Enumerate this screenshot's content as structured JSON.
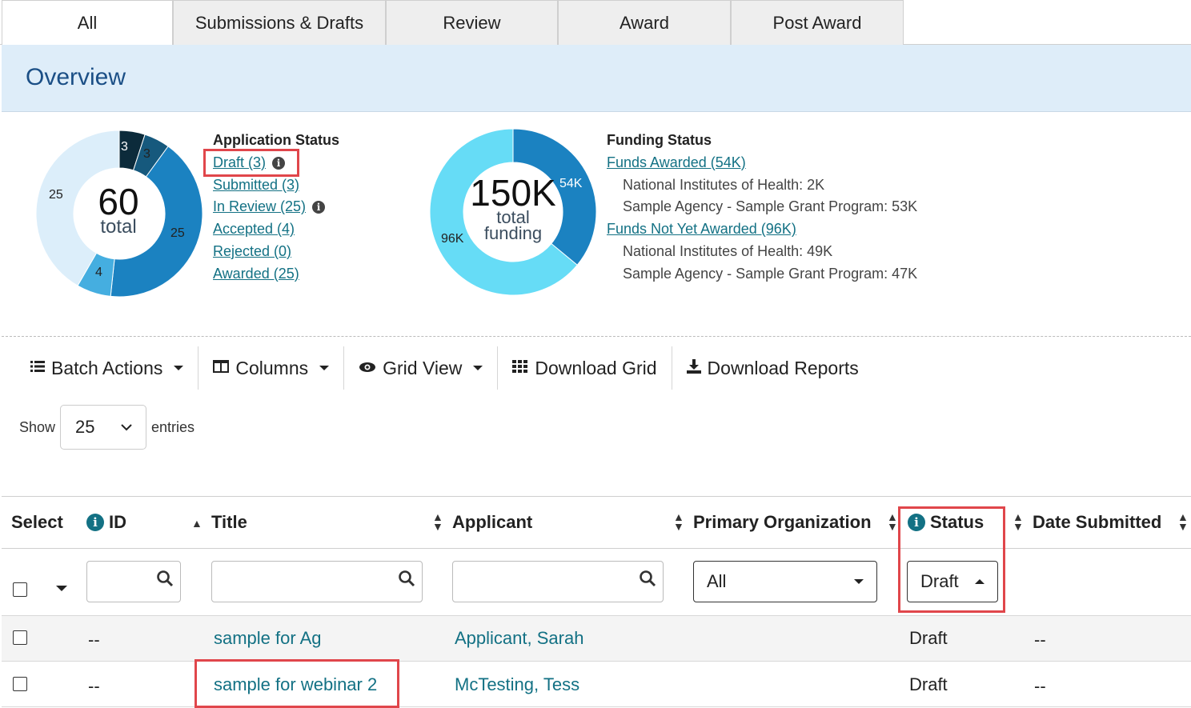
{
  "tabs": [
    "All",
    "Submissions & Drafts",
    "Review",
    "Award",
    "Post Award"
  ],
  "overview": {
    "title": "Overview"
  },
  "application_chart": {
    "center_value": "60",
    "center_label": "total",
    "segments": [
      {
        "label": "3",
        "value": 3,
        "color": "#0c2b3b"
      },
      {
        "label": "3",
        "value": 3,
        "color": "#16597d"
      },
      {
        "label": "25",
        "value": 25,
        "color": "#1b82c1"
      },
      {
        "label": "4",
        "value": 4,
        "color": "#45aee0"
      },
      {
        "label": "25",
        "value": 25,
        "color": "#dceefa"
      }
    ]
  },
  "application_status": {
    "title": "Application Status",
    "items": [
      {
        "label": "Draft (3)",
        "info": true
      },
      {
        "label": "Submitted (3)",
        "info": false
      },
      {
        "label": "In Review (25)",
        "info": true
      },
      {
        "label": "Accepted (4)",
        "info": false
      },
      {
        "label": "Rejected (0)",
        "info": false
      },
      {
        "label": "Awarded (25)",
        "info": false
      }
    ]
  },
  "funding_chart": {
    "center_value": "150K",
    "center_label_1": "total",
    "center_label_2": "funding",
    "segments": [
      {
        "label": "54K",
        "value": 54,
        "color": "#1b82c1"
      },
      {
        "label": "96K",
        "value": 96,
        "color": "#66dcf6"
      }
    ]
  },
  "funding_status": {
    "title": "Funding Status",
    "awarded_link": "Funds Awarded (54K)",
    "awarded_lines": [
      "National Institutes of Health: 2K",
      "Sample Agency - Sample Grant Program: 53K"
    ],
    "not_awarded_link": "Funds Not Yet Awarded (96K)",
    "not_awarded_lines": [
      "National Institutes of Health: 49K",
      "Sample Agency - Sample Grant Program: 47K"
    ]
  },
  "toolbar": {
    "batch_actions": "Batch Actions",
    "columns": "Columns",
    "grid_view": "Grid View",
    "download_grid": "Download Grid",
    "download_reports": "Download Reports"
  },
  "show_entries": {
    "show": "Show",
    "value": "25",
    "entries": "entries"
  },
  "table": {
    "headers": {
      "select": "Select",
      "id": "ID",
      "title": "Title",
      "applicant": "Applicant",
      "primary_org": "Primary Organization",
      "status": "Status",
      "date_submitted": "Date Submitted"
    },
    "filters": {
      "primary_org": "All",
      "status": "Draft"
    },
    "rows": [
      {
        "id": "--",
        "title": "sample for Ag",
        "applicant": "Applicant, Sarah",
        "status": "Draft",
        "date": "--"
      },
      {
        "id": "--",
        "title": "sample for webinar 2",
        "applicant": "McTesting, Tess",
        "status": "Draft",
        "date": "--"
      }
    ]
  },
  "colors": {
    "link": "#137184",
    "highlight": "#e0464b",
    "overview_bg": "#deedf9"
  }
}
